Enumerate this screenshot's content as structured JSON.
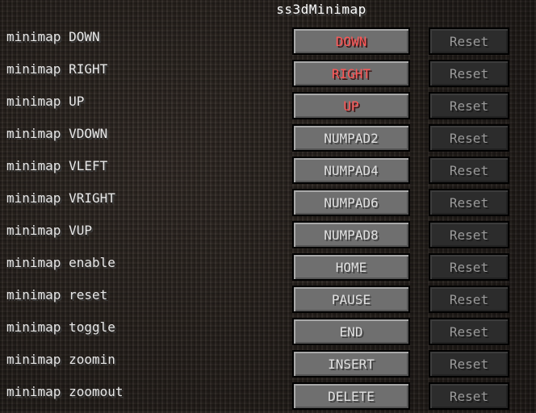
{
  "screen": {
    "title": "ss3dMinimap"
  },
  "colors": {
    "conflict_text": "#ff5555",
    "normal_text": "#e0e0e0",
    "disabled_text": "#9a9a9a"
  },
  "bindings": [
    {
      "action": "minimap DOWN",
      "key": "DOWN",
      "conflict": true,
      "reset": "Reset"
    },
    {
      "action": "minimap RIGHT",
      "key": "RIGHT",
      "conflict": true,
      "reset": "Reset"
    },
    {
      "action": "minimap UP",
      "key": "UP",
      "conflict": true,
      "reset": "Reset"
    },
    {
      "action": "minimap VDOWN",
      "key": "NUMPAD2",
      "conflict": false,
      "reset": "Reset"
    },
    {
      "action": "minimap VLEFT",
      "key": "NUMPAD4",
      "conflict": false,
      "reset": "Reset"
    },
    {
      "action": "minimap VRIGHT",
      "key": "NUMPAD6",
      "conflict": false,
      "reset": "Reset"
    },
    {
      "action": "minimap VUP",
      "key": "NUMPAD8",
      "conflict": false,
      "reset": "Reset"
    },
    {
      "action": "minimap enable",
      "key": "HOME",
      "conflict": false,
      "reset": "Reset"
    },
    {
      "action": "minimap reset",
      "key": "PAUSE",
      "conflict": false,
      "reset": "Reset"
    },
    {
      "action": "minimap toggle",
      "key": "END",
      "conflict": false,
      "reset": "Reset"
    },
    {
      "action": "minimap zoomin",
      "key": "INSERT",
      "conflict": false,
      "reset": "Reset"
    },
    {
      "action": "minimap zoomout",
      "key": "DELETE",
      "conflict": false,
      "reset": "Reset"
    }
  ]
}
